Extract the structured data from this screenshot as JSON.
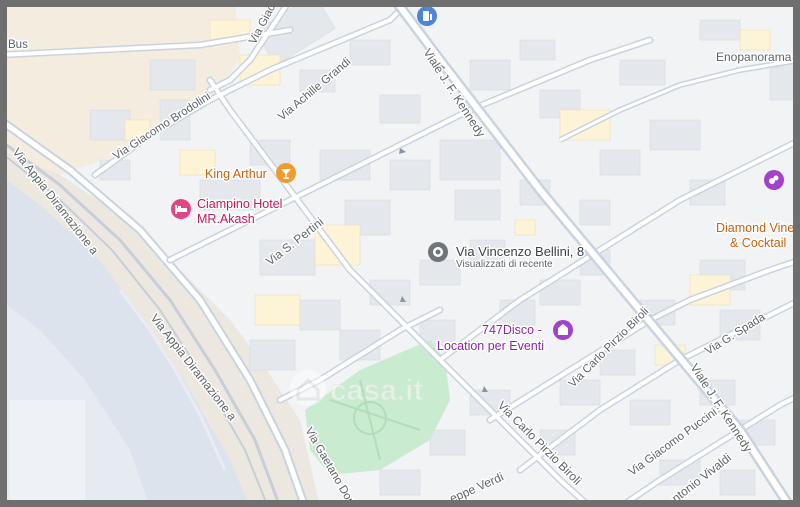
{
  "map": {
    "labels": {
      "bus": "Bus",
      "enopanorama": "Enopanorama",
      "via_giacomo": "Via Giaco",
      "via_achille_grandi": "Via Achille Grandi",
      "via_giacomo_brodolini": "Via Giacomo Brodolini",
      "viale_kennedy_top": "Viale J. F. Kennedy",
      "viale_kennedy_bottom": "Viale J. F. Kennedy",
      "via_appia_1": "Via Appia Diramazione a",
      "via_appia_2": "Via Appia Diramazione a",
      "via_pertini": "Via S. Pertini",
      "via_gaetano": "Via Gaetano Don",
      "via_carlo_pirzio": "Via Carlo Pirzio Biroli",
      "via_carlo_pirzio_small": "Via Carlo Pirzio Biroli",
      "via_giuseppe_verdi": "eppe Verdi",
      "via_g_spada": "Via G. Spada",
      "via_giacomo_puccini": "Via Giacomo Puccini",
      "antonio_vivaldi": "ntonio Vivaldi"
    },
    "pois": {
      "king_arthur": "King Arthur",
      "hotel_line1": "Ciampino Hotel",
      "hotel_line2": "MR.Akash",
      "disco_line1": "747Disco -",
      "disco_line2": "Location per Eventi",
      "diamond_line1": "Diamond Vine",
      "diamond_line2": "& Cocktail"
    },
    "pin": {
      "address": "Via Vincenzo Bellini, 8",
      "subtitle": "Visualizzati di recente"
    },
    "watermark": "casa.it",
    "colors": {
      "land": "#f1f3f4",
      "road": "#ffffff",
      "road_casing": "#d6dde6",
      "main_road": "#c9d3df",
      "building": "#e4e7eb",
      "commercial": "#fdf3d6",
      "park": "#c9ebd0",
      "sand": "#f3ecdf",
      "runway": "#dfe5ee",
      "poi_orange": "#f29a2e",
      "poi_pink": "#e24486",
      "poi_purple": "#a142c8",
      "pin_gray": "#70757a"
    },
    "icons": {
      "fuel": "fuel-icon",
      "bar": "cocktail-icon",
      "hotel": "bed-icon",
      "disco": "nightclub-icon",
      "wine": "wine-icon",
      "pin": "location-pin-icon",
      "watermark": "house-icon"
    }
  }
}
